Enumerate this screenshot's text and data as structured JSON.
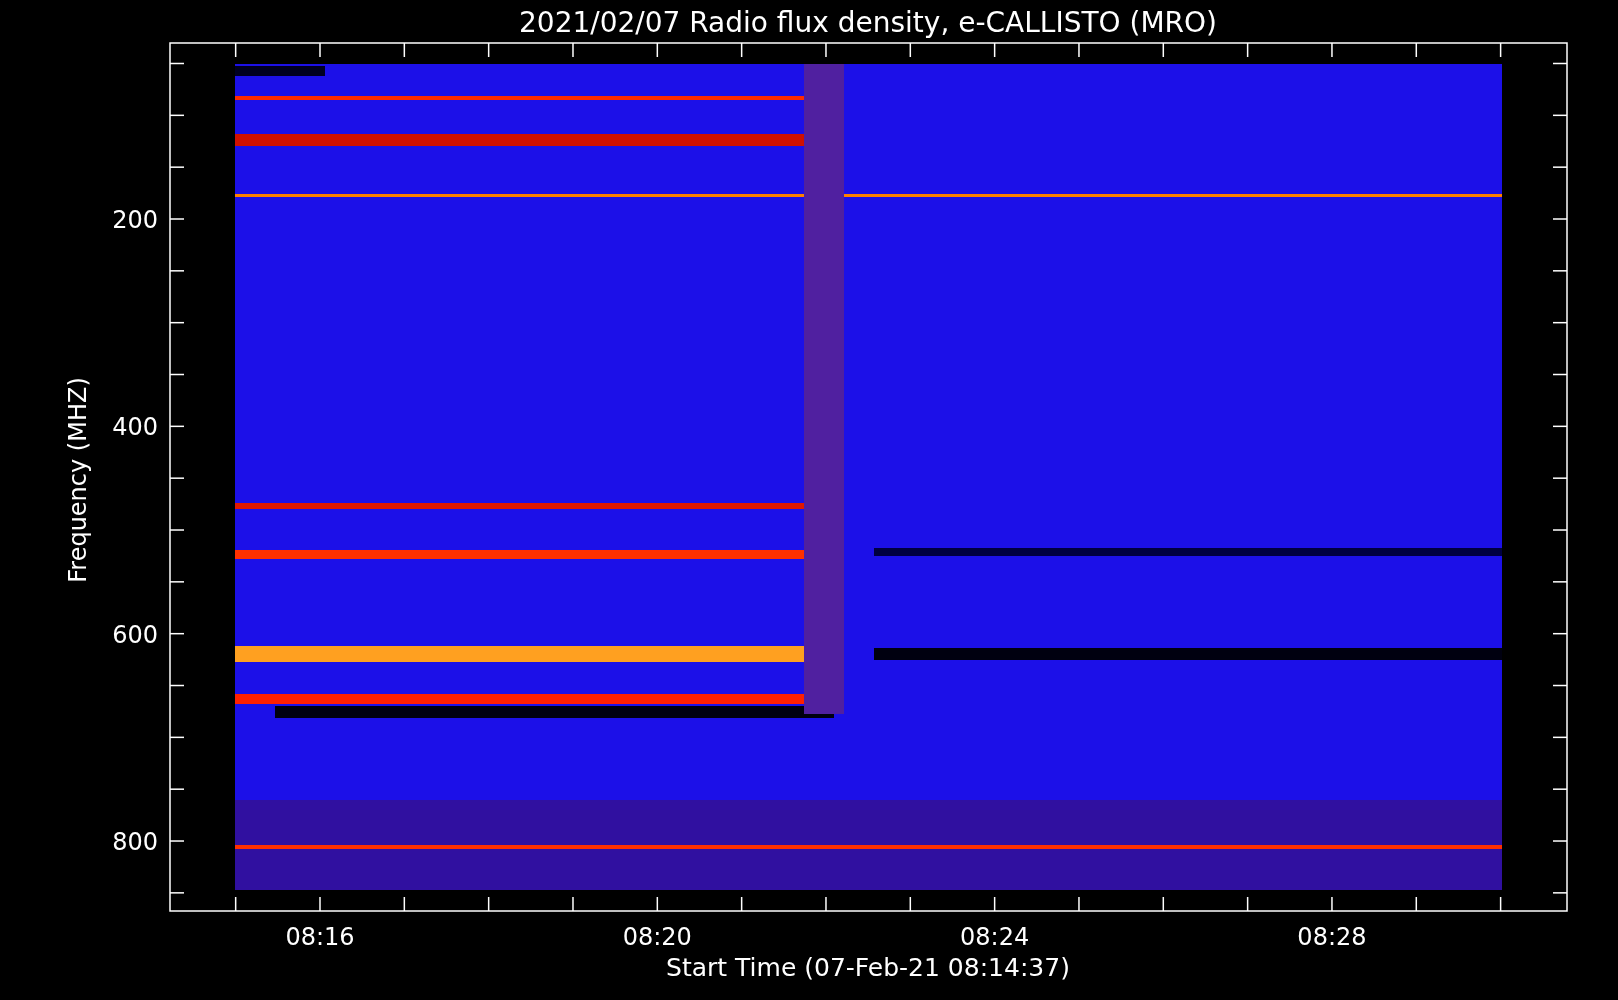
{
  "title": "2021/02/07  Radio flux density, e-CALLISTO (MRO)",
  "ylabel": "Frequency (MHZ)",
  "xlabel": "Start Time (07-Feb-21 08:14:37)",
  "yticks": [
    "200",
    "400",
    "600",
    "800"
  ],
  "xticks": [
    "08:16",
    "08:20",
    "08:24",
    "08:28"
  ]
}
